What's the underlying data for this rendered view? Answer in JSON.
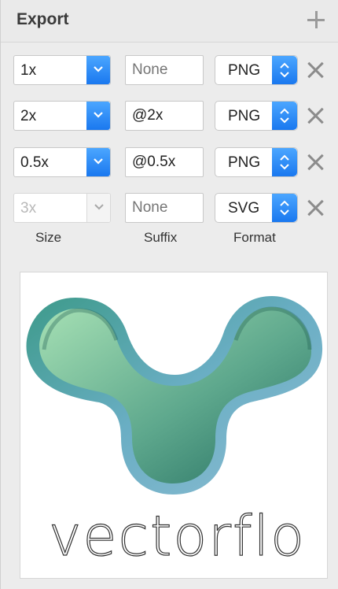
{
  "panel": {
    "title": "Export",
    "add_icon": "plus-icon"
  },
  "rows": [
    {
      "size": "1x",
      "suffix": "",
      "suffix_placeholder": "None",
      "format": "PNG",
      "enabled": true
    },
    {
      "size": "2x",
      "suffix": "@2x",
      "suffix_placeholder": "None",
      "format": "PNG",
      "enabled": true
    },
    {
      "size": "0.5x",
      "suffix": "@0.5x",
      "suffix_placeholder": "None",
      "format": "PNG",
      "enabled": true
    },
    {
      "size": "3x",
      "suffix": "",
      "suffix_placeholder": "None",
      "format": "SVG",
      "enabled": false
    }
  ],
  "labels": {
    "size": "Size",
    "suffix": "Suffix",
    "format": "Format"
  },
  "preview": {
    "logo_text": "vectorflo"
  },
  "colors": {
    "accent": "#1a78ef",
    "logo_outer": "#6fb0c4",
    "logo_inner_light": "#9fdcb0",
    "logo_inner_dark": "#2a7e6c"
  }
}
